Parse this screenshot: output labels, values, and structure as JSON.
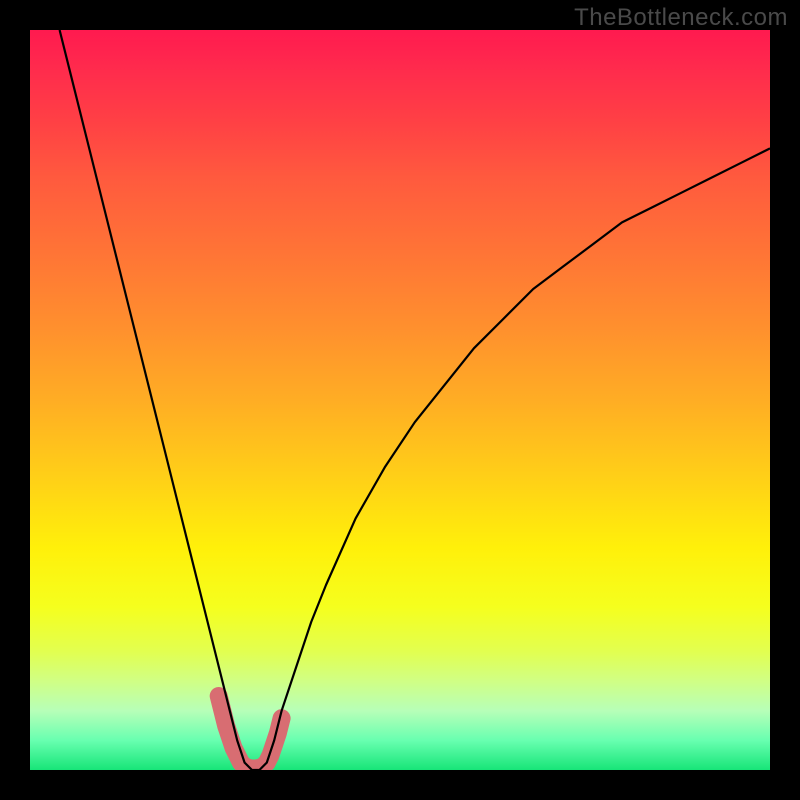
{
  "watermark": "TheBottleneck.com",
  "chart_data": {
    "type": "line",
    "title": "",
    "xlabel": "",
    "ylabel": "",
    "xlim": [
      0,
      100
    ],
    "ylim": [
      0,
      100
    ],
    "series": [
      {
        "name": "bottleneck-curve",
        "x": [
          4,
          6,
          8,
          10,
          12,
          14,
          16,
          18,
          20,
          22,
          24,
          25,
          26,
          27,
          28,
          29,
          30,
          31,
          32,
          33,
          34,
          36,
          38,
          40,
          44,
          48,
          52,
          56,
          60,
          64,
          68,
          72,
          76,
          80,
          84,
          88,
          92,
          96,
          100
        ],
        "y": [
          100,
          92,
          84,
          76,
          68,
          60,
          52,
          44,
          36,
          28,
          20,
          16,
          12,
          8,
          4,
          1,
          0,
          0,
          1,
          4,
          8,
          14,
          20,
          25,
          34,
          41,
          47,
          52,
          57,
          61,
          65,
          68,
          71,
          74,
          76,
          78,
          80,
          82,
          84
        ]
      }
    ],
    "highlight": {
      "name": "near-zero-band",
      "x": [
        25.5,
        26.5,
        27.5,
        28.5,
        29.0,
        29.5,
        30.0,
        30.5,
        31.0,
        31.5,
        32.0,
        32.5,
        33.0,
        33.5,
        34.0
      ],
      "y": [
        10,
        6,
        3,
        1,
        0.5,
        0.3,
        0.2,
        0.2,
        0.3,
        0.5,
        1,
        2,
        3.5,
        5,
        7
      ],
      "color": "#d86d72"
    },
    "gradient_stops": [
      {
        "pos": 0,
        "color": "#ff1a4f"
      },
      {
        "pos": 50,
        "color": "#ffad24"
      },
      {
        "pos": 78,
        "color": "#f5ff1e"
      },
      {
        "pos": 100,
        "color": "#17e578"
      }
    ]
  }
}
